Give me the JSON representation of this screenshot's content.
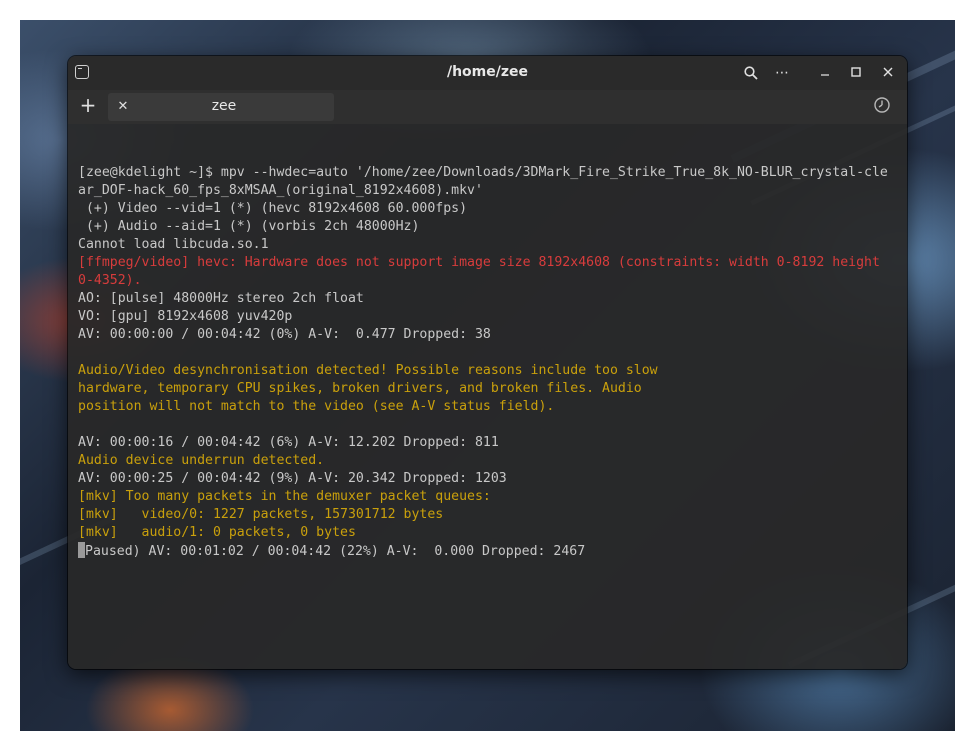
{
  "window": {
    "title": "/home/zee",
    "tab_label": "zee"
  },
  "icons": {
    "app": "terminal-icon",
    "search": "search-icon",
    "menu": "more-horizontal-icon",
    "minimize": "minimize-icon",
    "maximize": "maximize-icon",
    "close": "close-icon",
    "new_tab": "plus-icon",
    "tab_close": "close-icon",
    "history": "clock-icon"
  },
  "glyphs": {
    "new_tab": "+",
    "tab_close": "✕",
    "menu": "⋯"
  },
  "colors": {
    "default_text": "#c8c8c8",
    "error_text": "#d83c3c",
    "warning_text": "#c9a00c",
    "background": "#282828"
  },
  "terminal": {
    "lines": [
      {
        "text": "[zee@kdelight ~]$ mpv --hwdec=auto '/home/zee/Downloads/3DMark_Fire_Strike_True_8k_NO-BLUR_crystal-cle",
        "style": "default"
      },
      {
        "text": "ar_DOF-hack_60_fps_8xMSAA_(original_8192x4608).mkv'",
        "style": "default"
      },
      {
        "text": " (+) Video --vid=1 (*) (hevc 8192x4608 60.000fps)",
        "style": "default"
      },
      {
        "text": " (+) Audio --aid=1 (*) (vorbis 2ch 48000Hz)",
        "style": "default"
      },
      {
        "text": "Cannot load libcuda.so.1",
        "style": "default"
      },
      {
        "text": "[ffmpeg/video] hevc: Hardware does not support image size 8192x4608 (constraints: width 0-8192 height",
        "style": "error"
      },
      {
        "text": "0-4352).",
        "style": "error"
      },
      {
        "text": "AO: [pulse] 48000Hz stereo 2ch float",
        "style": "default"
      },
      {
        "text": "VO: [gpu] 8192x4608 yuv420p",
        "style": "default"
      },
      {
        "text": "AV: 00:00:00 / 00:04:42 (0%) A-V:  0.477 Dropped: 38",
        "style": "default"
      },
      {
        "text": "",
        "style": "default"
      },
      {
        "text": "Audio/Video desynchronisation detected! Possible reasons include too slow",
        "style": "warn"
      },
      {
        "text": "hardware, temporary CPU spikes, broken drivers, and broken files. Audio",
        "style": "warn"
      },
      {
        "text": "position will not match to the video (see A-V status field).",
        "style": "warn"
      },
      {
        "text": "",
        "style": "default"
      },
      {
        "text": "AV: 00:00:16 / 00:04:42 (6%) A-V: 12.202 Dropped: 811",
        "style": "default"
      },
      {
        "text": "Audio device underrun detected.",
        "style": "warn"
      },
      {
        "text": "AV: 00:00:25 / 00:04:42 (9%) A-V: 20.342 Dropped: 1203",
        "style": "default"
      },
      {
        "text": "[mkv] Too many packets in the demuxer packet queues:",
        "style": "warn"
      },
      {
        "text": "[mkv]   video/0: 1227 packets, 157301712 bytes",
        "style": "warn"
      },
      {
        "text": "[mkv]   audio/1: 0 packets, 0 bytes",
        "style": "warn"
      }
    ],
    "status_line": "Paused) AV: 00:01:02 / 00:04:42 (22%) A-V:  0.000 Dropped: 2467"
  }
}
